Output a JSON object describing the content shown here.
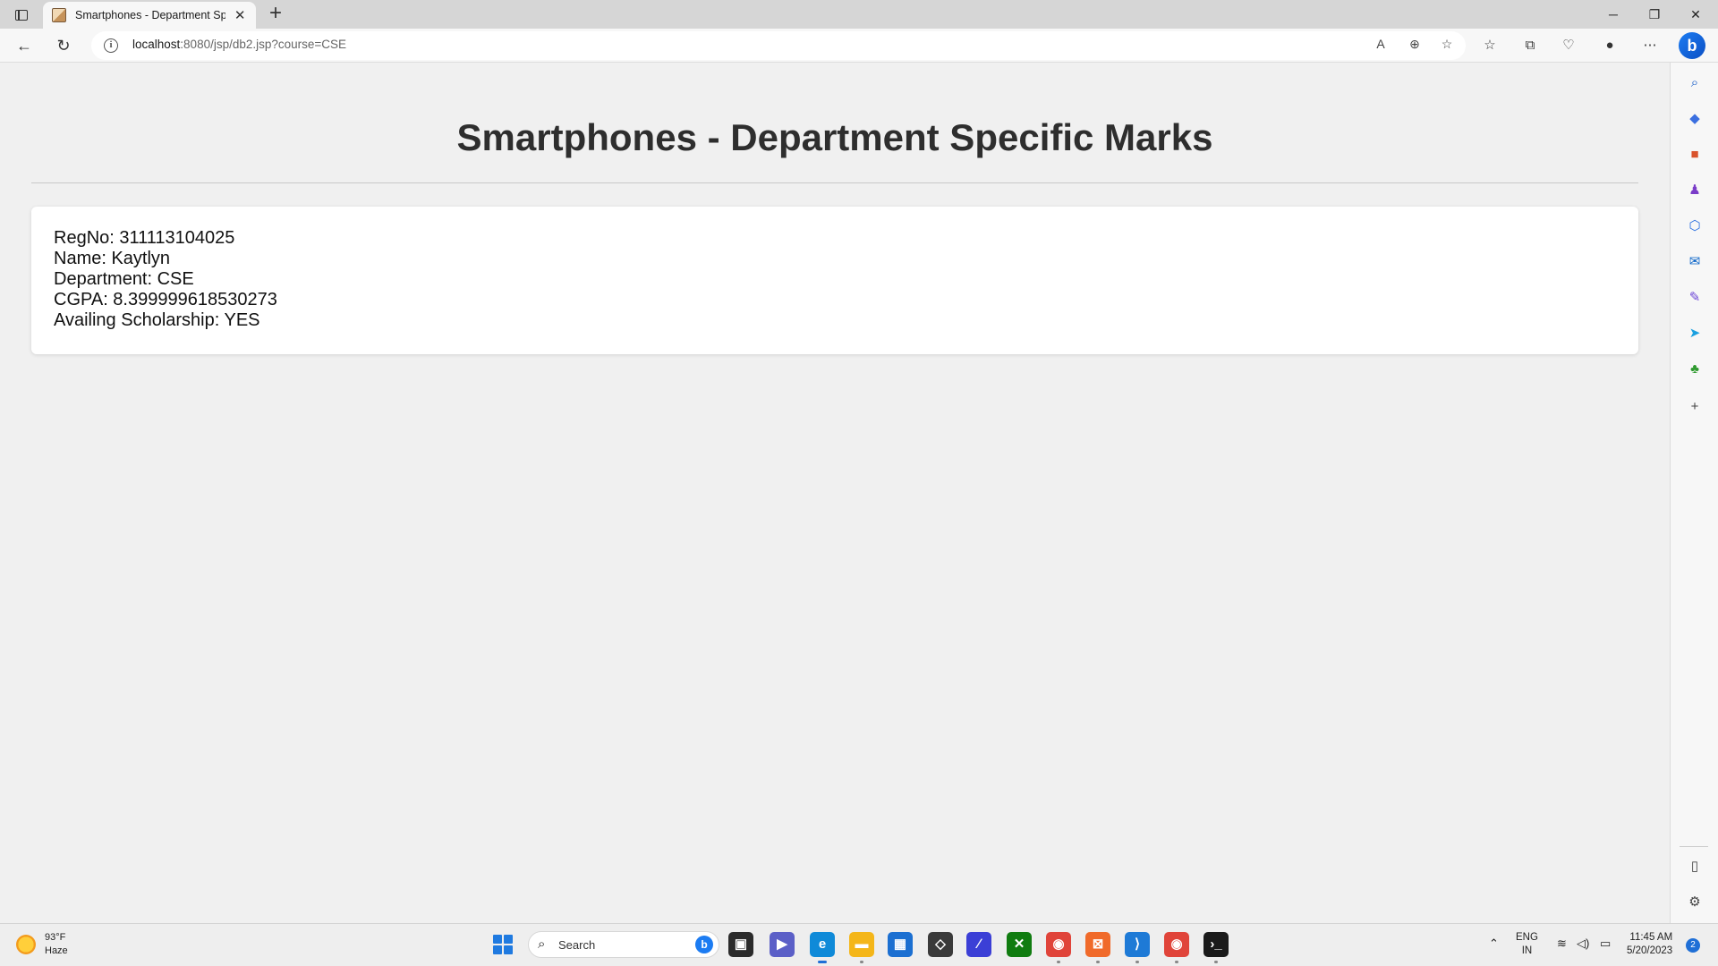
{
  "browser": {
    "tab_title": "Smartphones - Department Specific Marks",
    "url_host": "localhost",
    "url_rest": ":8080/jsp/db2.jsp?course=CSE"
  },
  "page": {
    "title": "Smartphones - Department Specific Marks",
    "record": {
      "regno": "RegNo: 311113104025",
      "name": "Name: Kaytlyn",
      "department": "Department: CSE",
      "cgpa": "CGPA: 8.399999618530273",
      "scholarship": "Availing Scholarship: YES"
    }
  },
  "taskbar": {
    "weather_temp": "93°F",
    "weather_desc": "Haze",
    "search_placeholder": "Search",
    "lang_top": "ENG",
    "lang_bottom": "IN",
    "time": "11:45 AM",
    "date": "5/20/2023",
    "notification_count": "2"
  },
  "colors": {
    "page_bg": "#f0f0f0",
    "card_bg": "#ffffff",
    "title_color": "#2e2e2e",
    "accent": "#1f6fd6"
  }
}
